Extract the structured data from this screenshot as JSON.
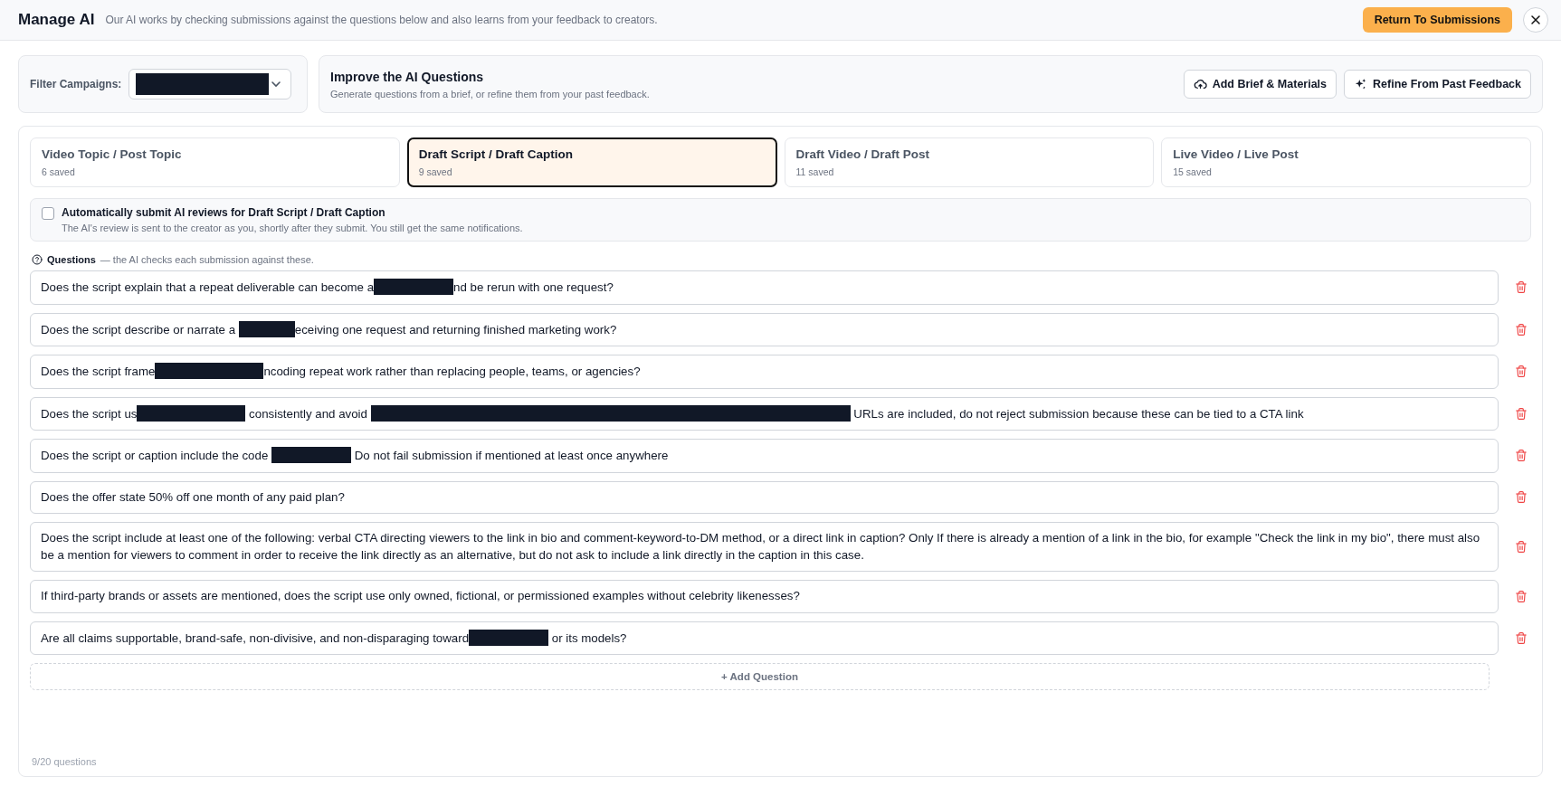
{
  "header": {
    "title": "Manage AI",
    "subtitle": "Our AI works by checking submissions against the questions below and also learns from your feedback to creators.",
    "return_button": "Return To Submissions"
  },
  "filter": {
    "label": "Filter Campaigns:",
    "value_redacted": true
  },
  "improve": {
    "title": "Improve the AI Questions",
    "description": "Generate questions from a brief, or refine them from your past feedback.",
    "buttons": [
      {
        "kind": "upload",
        "label": "Add Brief & Materials"
      },
      {
        "kind": "sparkle",
        "label": "Refine From Past Feedback"
      }
    ]
  },
  "tabs": [
    {
      "label": "Video Topic / Post Topic",
      "count": "6 saved",
      "selected": false
    },
    {
      "label": "Draft Script / Draft Caption",
      "count": "9 saved",
      "selected": true
    },
    {
      "label": "Draft Video / Draft Post",
      "count": "11 saved",
      "selected": false
    },
    {
      "label": "Live Video / Live Post",
      "count": "15 saved",
      "selected": false
    }
  ],
  "auto_submit": {
    "checked": false,
    "label": "Automatically submit AI reviews for Draft Script / Draft Caption",
    "description": "The AI's review is sent to the creator as you, shortly after they submit. You still get the same notifications."
  },
  "questions_heading": {
    "title": "Questions",
    "note": "— the AI checks each submission against these."
  },
  "questions": [
    {
      "parts": [
        {
          "kind": "text",
          "text": "Does the script explain that a repeat deliverable can become a"
        },
        {
          "kind": "redacted_small"
        },
        {
          "kind": "text",
          "text": "nd be rerun with one request?"
        }
      ]
    },
    {
      "parts": [
        {
          "kind": "text",
          "text": "Does the script describe or narrate a "
        },
        {
          "kind": "redacted_tiny"
        },
        {
          "kind": "text",
          "text": "eceiving one request and returning finished marketing work?"
        }
      ]
    },
    {
      "parts": [
        {
          "kind": "text",
          "text": "Does the script frame"
        },
        {
          "kind": "redacted_medium"
        },
        {
          "kind": "text",
          "text": "ncoding repeat work rather than replacing people, teams, or agencies?"
        }
      ]
    },
    {
      "parts": [
        {
          "kind": "text",
          "text": "Does the script us"
        },
        {
          "kind": "redacted_medium"
        },
        {
          "kind": "text",
          "text": " consistently and avoid "
        },
        {
          "kind": "redacted_wide"
        },
        {
          "kind": "text",
          "text": " URLs are included, do not reject submission because these can be tied to a CTA link"
        }
      ]
    },
    {
      "parts": [
        {
          "kind": "text",
          "text": "Does the script or caption include the code "
        },
        {
          "kind": "redacted_small"
        },
        {
          "kind": "text",
          "text": " Do not fail submission if mentioned at least once anywhere"
        }
      ]
    },
    {
      "parts": [
        {
          "kind": "text",
          "text": "Does the offer state 50% off one month of any paid plan?"
        }
      ]
    },
    {
      "parts": [
        {
          "kind": "text",
          "text": "Does the script include at least one of the following: verbal CTA directing viewers to the link in bio and comment-keyword-to-DM method, or a direct link in caption? Only If there is already a mention of a link in the bio, for example \"Check the link in my bio\", there must also be a mention for viewers to comment in order to receive the link directly as an alternative, but do not ask to include a link directly in the caption in this case."
        }
      ]
    },
    {
      "parts": [
        {
          "kind": "text",
          "text": "If third-party brands or assets are mentioned, does the script use only owned, fictional, or permissioned examples without celebrity likenesses?"
        }
      ]
    },
    {
      "parts": [
        {
          "kind": "text",
          "text": "Are all claims supportable, brand-safe, non-divisive, and non-disparaging toward"
        },
        {
          "kind": "redacted_small"
        },
        {
          "kind": "text",
          "text": " or its models?"
        }
      ]
    }
  ],
  "add_question": "+ Add Question",
  "footer": "9/20 questions"
}
